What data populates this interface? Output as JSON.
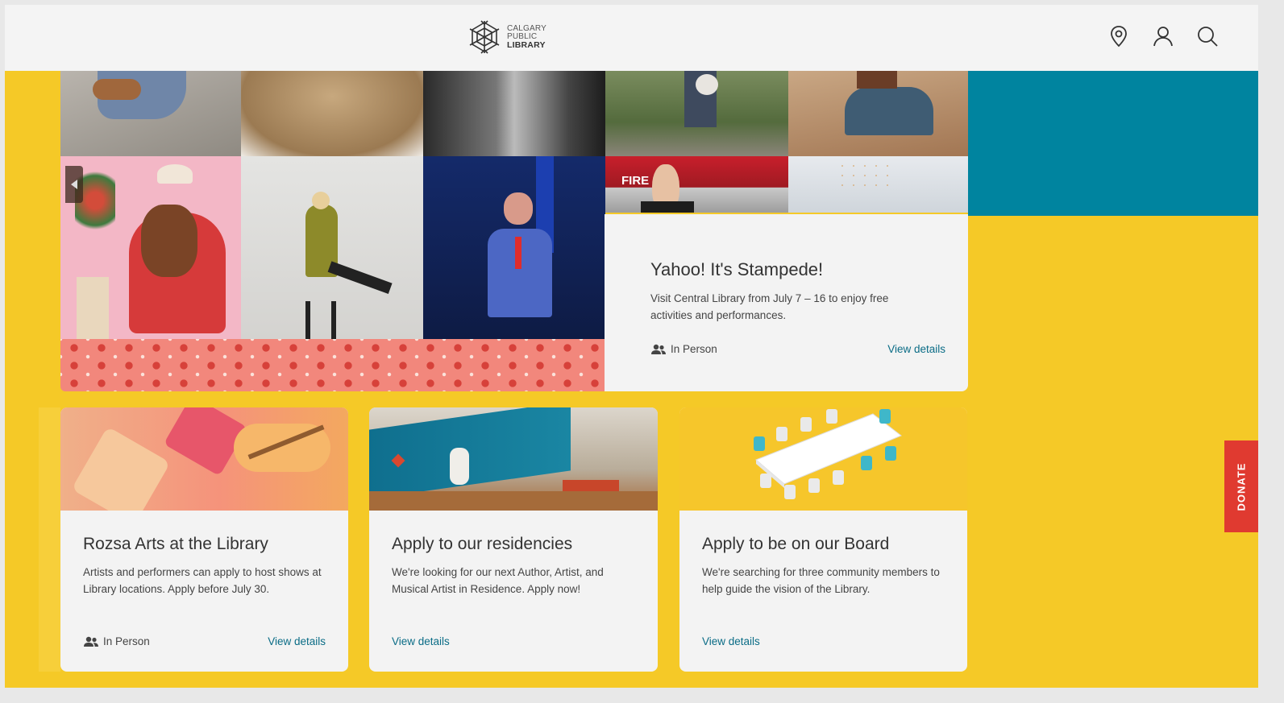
{
  "header": {
    "logo_lines": [
      "CALGARY",
      "PUBLIC",
      "LIBRARY"
    ],
    "icons": [
      "location-pin-icon",
      "user-account-icon",
      "search-icon"
    ]
  },
  "hero": {
    "title": "Yahoo! It's Stampede!",
    "description": "Visit Central Library from July 7 – 16 to enjoy free activities and performances.",
    "meta_label": "In Person",
    "link_label": "View details",
    "overlay_text": "FIRE"
  },
  "cards": [
    {
      "title": "Rozsa Arts at the Library",
      "description": "Artists and performers can apply to host shows at Library locations. Apply before July 30.",
      "meta_label": "In Person",
      "link_label": "View details"
    },
    {
      "title": "Apply to our residencies",
      "description": "We're looking for our next Author, Artist, and Musical Artist in Residence. Apply now!",
      "link_label": "View details"
    },
    {
      "title": "Apply to be on our Board",
      "description": "We're searching for three community members to help guide the vision of the Library.",
      "link_label": "View details"
    }
  ],
  "donate": {
    "label": "DONATE"
  },
  "colors": {
    "page_bg": "#f5c927",
    "teal": "#00849f",
    "header_bg": "#f4f4f4",
    "card_bg": "#f3f3f3",
    "link": "#0a6c86",
    "donate": "#e03a30"
  }
}
